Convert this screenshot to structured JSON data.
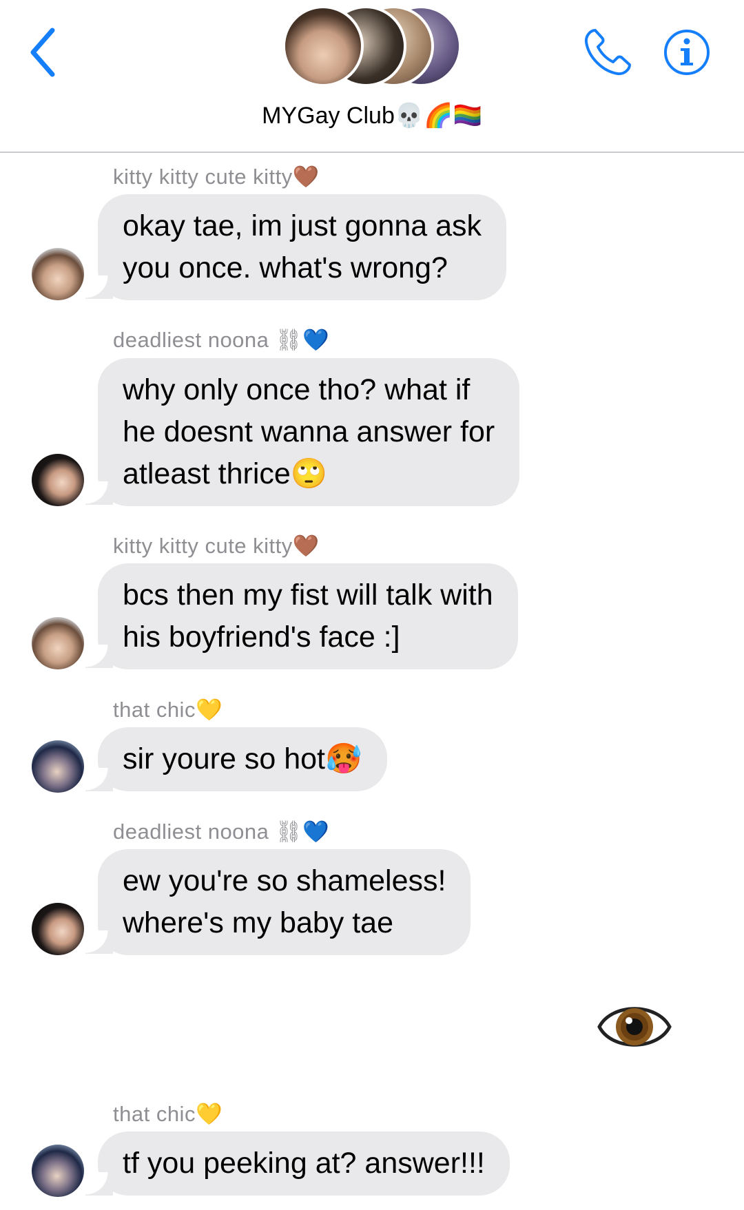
{
  "header": {
    "title": "MYGay Club💀🌈🏳️‍🌈",
    "back_icon": "chevron-left-icon",
    "call_icon": "phone-icon",
    "info_icon": "info-icon",
    "accent_color": "#147efb"
  },
  "messages": [
    {
      "sender": "kitty kitty cute kitty🤎",
      "lines": [
        "okay tae, im just gonna ask",
        "you once. what's wrong?"
      ]
    },
    {
      "sender": "deadliest noona ⛓💙",
      "lines": [
        "why only once tho? what if",
        "he doesnt wanna answer for",
        "atleast thrice🙄"
      ]
    },
    {
      "sender": "kitty kitty cute kitty🤎",
      "lines": [
        "bcs then my fist will talk with",
        "his boyfriend's face :]"
      ]
    },
    {
      "sender": "that chic💛",
      "lines": [
        "sir youre so hot🥵"
      ]
    },
    {
      "sender": "deadliest noona ⛓💙",
      "lines": [
        "ew you're so shameless!",
        "where's my baby tae"
      ]
    },
    {
      "sender": "that chic💛",
      "lines": [
        "tf you peeking at? answer!!!"
      ]
    }
  ],
  "outgoing": {
    "emoji": "👁",
    "icon": "eye-icon"
  },
  "colors": {
    "bubble_incoming": "#e9e9eb",
    "sender_label": "#8e8e93",
    "divider": "#c9c9ce"
  }
}
